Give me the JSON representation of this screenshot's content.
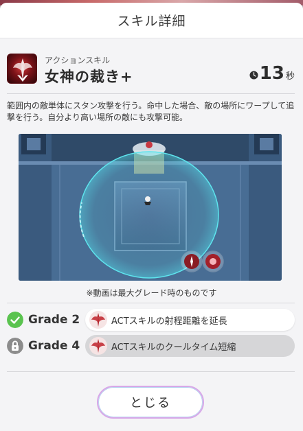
{
  "dialog": {
    "title": "スキル詳細"
  },
  "skill": {
    "type_label": "アクションスキル",
    "name": "女神の裁き+",
    "cooldown_value": "13",
    "cooldown_unit": "秒",
    "description": "範囲内の敵単体にスタン攻撃を行う。命中した場合、敵の場所にワープして追撃を行う。自分より高い場所の敵にも攻撃可能。"
  },
  "preview": {
    "note": "※動画は最大グレード時のものです"
  },
  "grades": [
    {
      "label": "Grade 2",
      "status": "unlocked",
      "status_icon": "check-circle-icon",
      "text": "ACTスキルの射程距離を延長"
    },
    {
      "label": "Grade 4",
      "status": "locked",
      "status_icon": "lock-icon",
      "text": "ACTスキルのクールタイム短縮"
    }
  ],
  "close_button": {
    "label": "とじる"
  },
  "colors": {
    "check_green": "#5ac34f",
    "lock_gray": "#8c8c8c",
    "accent_red": "#b3262c",
    "range_cyan": "#4fe0e6"
  }
}
